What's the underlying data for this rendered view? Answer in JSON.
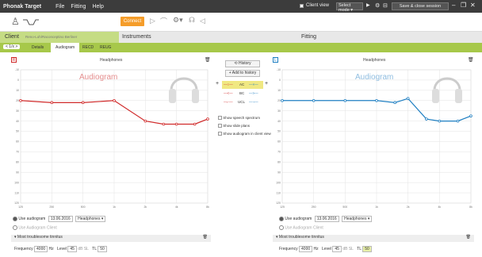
{
  "titlebar": {
    "app_title": "Phonak Target",
    "menu": [
      "File",
      "Fitting",
      "Help"
    ],
    "client_view_label": "Client view",
    "select_mode": "Select mode",
    "save_close_label": "Save & close session"
  },
  "toolbar": {
    "connect_label": "Connect"
  },
  "main_tabs": {
    "client": "Client",
    "client_sub": "Reno-Loh/Raconceptino Berliner",
    "instruments": "Instruments",
    "fitting": "Fitting"
  },
  "sub_tabs": {
    "back": "< 1/x >",
    "items": [
      "Details",
      "Audiogram",
      "RECD",
      "REUG"
    ]
  },
  "left_panel": {
    "header": "Headphones",
    "watermark": "Audiogram",
    "y_ticks": [
      "-10",
      "0",
      "10",
      "20",
      "30",
      "40",
      "50",
      "60",
      "70",
      "80",
      "90",
      "100",
      "110",
      "120"
    ],
    "x_ticks": [
      "125",
      "250",
      "500",
      "1k",
      "2k",
      "4k",
      "8k"
    ],
    "use_audiogram_label": "Use audiogram",
    "date": "13.06.2016",
    "transducer": "Headphones",
    "use_other_label": "Use Audiogram Client",
    "tinnitus_label": "Most troublesome tinnitus",
    "frequency_label": "Frequency",
    "frequency_value": "4000",
    "freq_unit": "Hz",
    "level_label": "Level",
    "level_value": "45",
    "level_unit": "dB SL",
    "tl_label": "TL",
    "tl_value": "50",
    "color": "#d02a2a"
  },
  "right_panel": {
    "header": "Headphones",
    "watermark": "Audiogram",
    "y_ticks": [
      "-10",
      "0",
      "10",
      "20",
      "30",
      "40",
      "50",
      "60",
      "70",
      "80",
      "90",
      "100",
      "110",
      "120"
    ],
    "x_ticks": [
      "125",
      "250",
      "500",
      "1k",
      "2k",
      "4k",
      "8k"
    ],
    "use_audiogram_label": "Use audiogram",
    "date": "13.06.2016",
    "transducer": "Headphones",
    "use_other_label": "Use Audiogram Client",
    "tinnitus_label": "Most troublesome tinnitus",
    "frequency_label": "Frequency",
    "frequency_value": "4000",
    "freq_unit": "Hz",
    "level_label": "Level",
    "level_value": "45",
    "level_unit": "dB SL",
    "tl_label": "TL",
    "tl_value": "50",
    "color": "#1f7fc2"
  },
  "center_controls": {
    "history_label": "History",
    "add_history_label": "Add to history",
    "legend_rows": [
      {
        "left": "AC",
        "right": ""
      },
      {
        "left": "BC",
        "right": ""
      },
      {
        "left": "UCL",
        "right": ""
      }
    ],
    "checks": [
      "Show speech spectrum",
      "Show slide plans",
      "Show audiogram in client view"
    ]
  },
  "chart_data": [
    {
      "type": "line",
      "series": [
        {
          "name": "Right AC",
          "x": [
            "125",
            "250",
            "500",
            "1k",
            "2k",
            "3k",
            "4k",
            "6k",
            "8k"
          ],
          "values": [
            20,
            22,
            22,
            20,
            40,
            43,
            43,
            43,
            38
          ]
        }
      ],
      "xlabel": "",
      "ylabel": "",
      "ylim": [
        -10,
        120
      ]
    },
    {
      "type": "line",
      "series": [
        {
          "name": "Left AC",
          "x": [
            "125",
            "250",
            "500",
            "1k",
            "1.5k",
            "2k",
            "3k",
            "4k",
            "6k",
            "8k"
          ],
          "values": [
            20,
            20,
            20,
            20,
            22,
            18,
            38,
            40,
            40,
            35
          ]
        }
      ],
      "xlabel": "",
      "ylabel": "",
      "ylim": [
        -10,
        120
      ]
    }
  ]
}
